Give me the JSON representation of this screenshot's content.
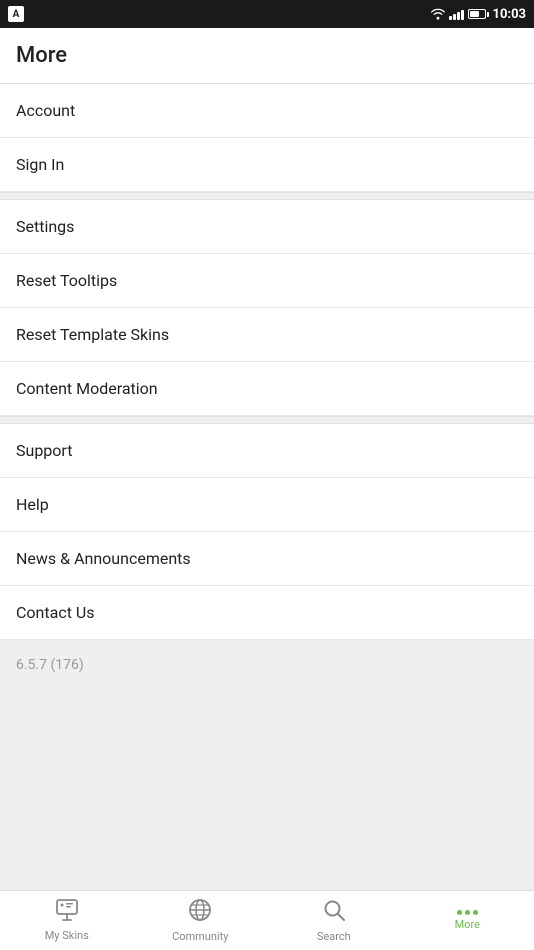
{
  "statusBar": {
    "time": "10:03"
  },
  "header": {
    "title": "More"
  },
  "menu": {
    "items": [
      {
        "id": "account",
        "label": "Account",
        "section": 1
      },
      {
        "id": "sign-in",
        "label": "Sign In",
        "section": 1
      },
      {
        "id": "settings",
        "label": "Settings",
        "section": 2
      },
      {
        "id": "reset-tooltips",
        "label": "Reset Tooltips",
        "section": 2
      },
      {
        "id": "reset-template-skins",
        "label": "Reset Template Skins",
        "section": 2
      },
      {
        "id": "content-moderation",
        "label": "Content Moderation",
        "section": 2
      },
      {
        "id": "support",
        "label": "Support",
        "section": 3
      },
      {
        "id": "help",
        "label": "Help",
        "section": 3
      },
      {
        "id": "news-announcements",
        "label": "News & Announcements",
        "section": 3
      },
      {
        "id": "contact-us",
        "label": "Contact Us",
        "section": 3
      }
    ],
    "version": "6.5.7 (176)"
  },
  "bottomNav": {
    "items": [
      {
        "id": "my-skins",
        "label": "My Skins",
        "icon": "monitor",
        "active": false
      },
      {
        "id": "community",
        "label": "Community",
        "icon": "globe",
        "active": false
      },
      {
        "id": "search",
        "label": "Search",
        "icon": "search",
        "active": false
      },
      {
        "id": "more",
        "label": "More",
        "icon": "dots",
        "active": true
      }
    ]
  }
}
